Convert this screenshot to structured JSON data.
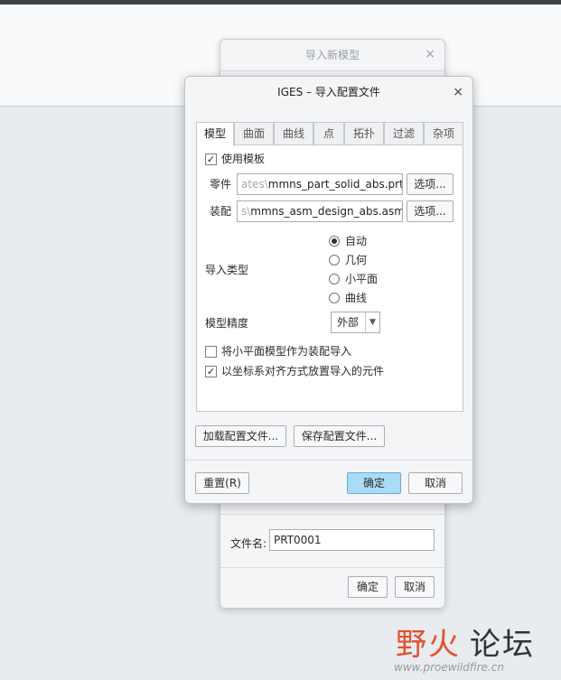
{
  "background_dialog": {
    "title": "导入新模型",
    "close": "×",
    "filename_label": "文件名:",
    "filename_value": "PRT0001",
    "ok_label": "确定",
    "cancel_label": "取消"
  },
  "dialog": {
    "title": "IGES – 导入配置文件",
    "close": "×",
    "tabs": [
      "模型",
      "曲面",
      "曲线",
      "点",
      "拓扑",
      "过滤",
      "杂项"
    ],
    "use_template_label": "使用模板",
    "use_template_checked": "✓",
    "part_label": "零件",
    "part_value_prefix": "ates\\",
    "part_value": "mmns_part_solid_abs.prt",
    "part_options": "选项...",
    "asm_label": "装配",
    "asm_value_prefix": "s\\",
    "asm_value": "mmns_asm_design_abs.asm",
    "asm_options": "选项...",
    "import_type_label": "导入类型",
    "import_types": [
      "自动",
      "几何",
      "小平面",
      "曲线"
    ],
    "selected_import_type": "自动",
    "precision_label": "模型精度",
    "precision_value": "外部",
    "facet_as_asm_label": "将小平面模型作为装配导入",
    "facet_as_asm_checked": "",
    "csys_align_label": "以坐标系对齐方式放置导入的元件",
    "csys_align_checked": "✓",
    "load_config_label": "加载配置文件...",
    "save_config_label": "保存配置文件...",
    "reset_label": "重置(R)",
    "ok_label": "确定",
    "cancel_label": "取消"
  },
  "watermark": {
    "brand_red": "野火",
    "brand_dark": "论坛",
    "url": "www.proewildfire.cn"
  }
}
